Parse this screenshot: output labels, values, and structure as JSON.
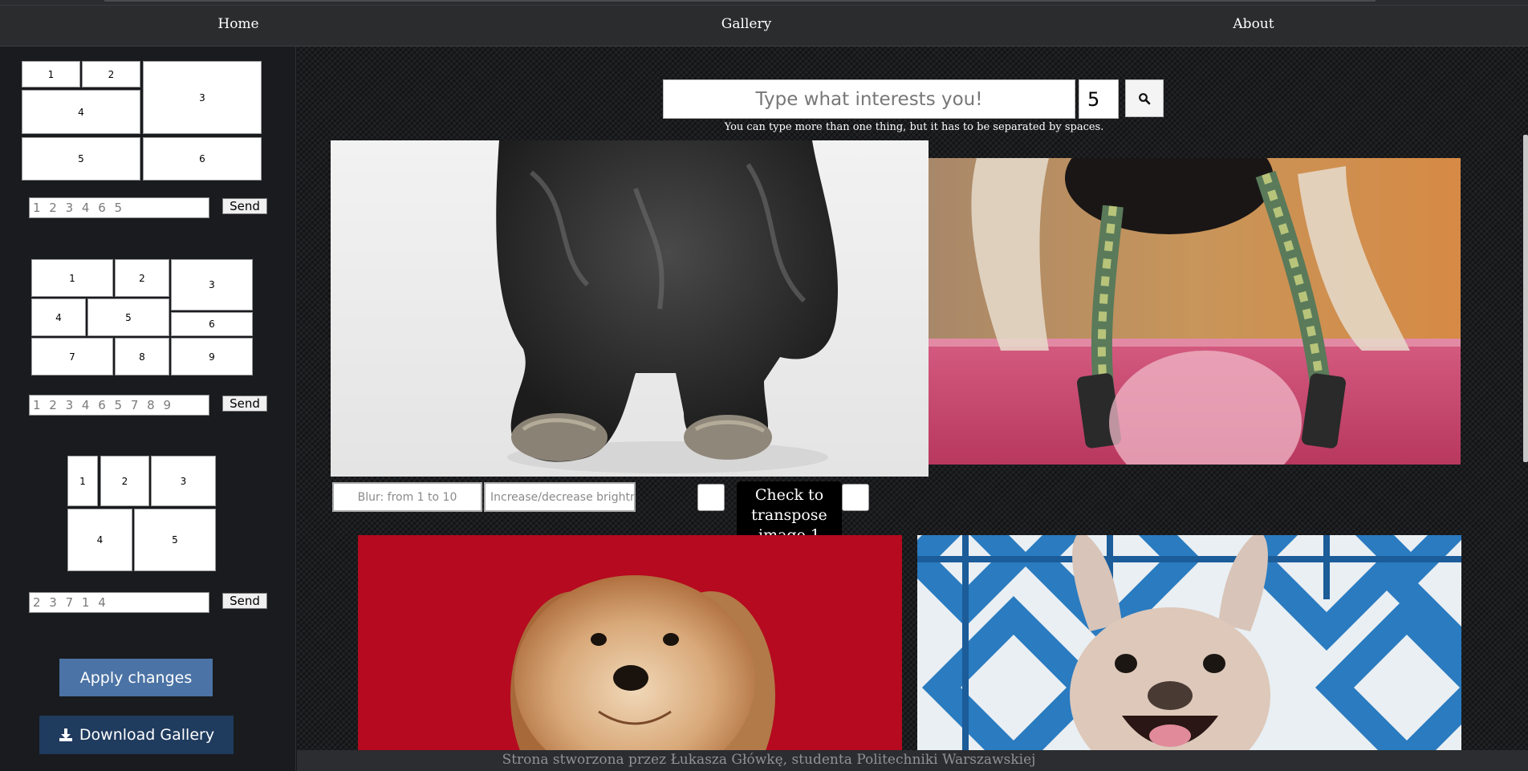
{
  "nav": {
    "home": "Home",
    "gallery": "Gallery",
    "about": "About"
  },
  "sidebar": {
    "layout1": {
      "tiles": [
        "1",
        "2",
        "3",
        "4",
        "5",
        "6"
      ],
      "input_placeholder": "1 2 3 4 6 5",
      "send_label": "Send"
    },
    "layout2": {
      "tiles": [
        "1",
        "2",
        "3",
        "4",
        "5",
        "6",
        "7",
        "8",
        "9"
      ],
      "input_placeholder": "1 2 3 4 6 5 7 8 9",
      "send_label": "Send"
    },
    "layout3": {
      "tiles": [
        "1",
        "2",
        "3",
        "4",
        "5"
      ],
      "input_placeholder": "2 3 7 1 4",
      "send_label": "Send"
    },
    "apply_label": "Apply changes",
    "download_label": "Download Gallery"
  },
  "search": {
    "placeholder": "Type what interests you!",
    "count": "5",
    "hint": "You can type more than one thing, but it has to be separated by spaces."
  },
  "controls": {
    "blur_placeholder": "Blur: from 1 to 10",
    "brightness_placeholder": "Increase/decrease brightn",
    "transpose_tooltip": "Check to transpose image 1"
  },
  "footer": {
    "text": "Strona stworzona przez Łukasza Główkę, studenta Politechniki Warszawskiej"
  },
  "colors": {
    "apply_button": "#4b73a5",
    "download_button": "#1f3b5e",
    "nav_bg": "#2b2c2e",
    "sidebar_bg": "#191b1e"
  }
}
